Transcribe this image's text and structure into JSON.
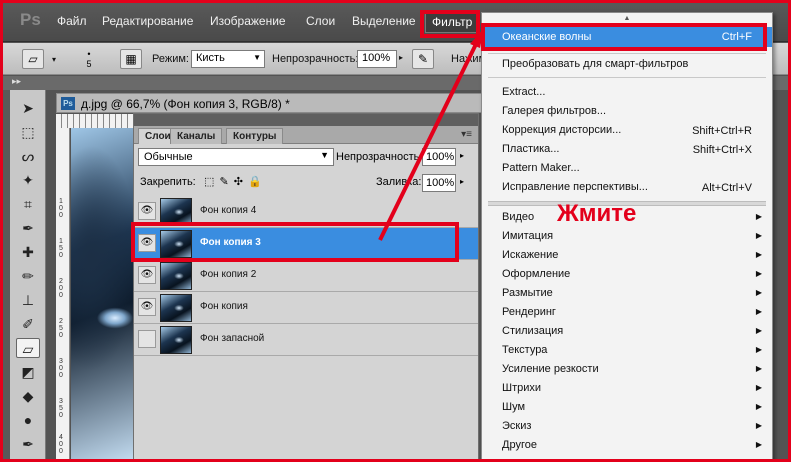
{
  "menubar": {
    "logo": "Ps",
    "items": [
      {
        "label": "Файл"
      },
      {
        "label": "Редактирование"
      },
      {
        "label": "Изображение"
      },
      {
        "label": "Слои"
      },
      {
        "label": "Выделение"
      },
      {
        "label": "Фильтр"
      }
    ]
  },
  "options_bar": {
    "brush_size": "5",
    "mode_label": "Режим:",
    "mode_value": "Кисть",
    "opacity_label": "Непрозрачность:",
    "opacity_value": "100%",
    "cut_label": "Нажим"
  },
  "document": {
    "ps_badge": "Ps",
    "title": "д.jpg @ 66,7% (Фон копия 3, RGB/8) *",
    "ruler_marks": [
      "100",
      "150",
      "200",
      "250",
      "300",
      "350",
      "400"
    ]
  },
  "layers_panel": {
    "tabs": [
      "Слои",
      "Каналы",
      "Контуры"
    ],
    "panel_menu_glyph": "▾≡",
    "blend_mode": "Обычные",
    "opacity_label": "Непрозрачность:",
    "opacity_value": "100%",
    "lock_label": "Закрепить:",
    "lock_icons": "⬚ ✎ ✣ 🔒",
    "fill_label": "Заливка:",
    "fill_value": "100%",
    "layers": [
      {
        "name": "Фон копия 4",
        "visible": true,
        "selected": false
      },
      {
        "name": "Фон копия 3",
        "visible": true,
        "selected": true
      },
      {
        "name": "Фон копия 2",
        "visible": true,
        "selected": false
      },
      {
        "name": "Фон копия",
        "visible": true,
        "selected": false
      },
      {
        "name": "Фон запасной",
        "visible": false,
        "selected": false
      }
    ]
  },
  "filter_menu": {
    "top_items": [
      {
        "label": "Океанские волны",
        "shortcut": "Ctrl+F"
      },
      {
        "label": "Преобразовать для смарт-фильтров",
        "shortcut": ""
      }
    ],
    "plugin_items": [
      {
        "label": "Extract...",
        "shortcut": ""
      },
      {
        "label": "Галерея фильтров...",
        "shortcut": ""
      },
      {
        "label": "Коррекция дисторсии...",
        "shortcut": "Shift+Ctrl+R"
      },
      {
        "label": "Пластика...",
        "shortcut": "Shift+Ctrl+X"
      },
      {
        "label": "Pattern Maker...",
        "shortcut": ""
      },
      {
        "label": "Исправление перспективы...",
        "shortcut": "Alt+Ctrl+V"
      }
    ],
    "submenus": [
      "Видео",
      "Имитация",
      "Искажение",
      "Оформление",
      "Размытие",
      "Рендеринг",
      "Стилизация",
      "Текстура",
      "Усиление резкости",
      "Штрихи",
      "Шум",
      "Эскиз",
      "Другое"
    ]
  },
  "annotation": {
    "text": "Жмите",
    "color": "#e3001b"
  },
  "colors": {
    "highlight_blue": "#3a8de0",
    "annotation_red": "#e3001b"
  }
}
